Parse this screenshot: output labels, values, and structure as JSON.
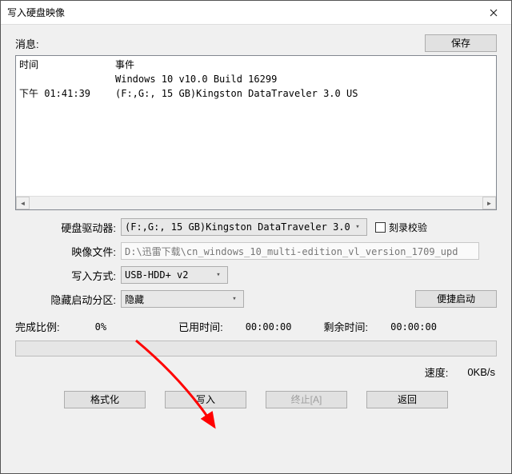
{
  "window": {
    "title": "写入硬盘映像"
  },
  "info_section": {
    "label": "消息:",
    "save_button": "保存",
    "headers": {
      "time": "时间",
      "event": "事件"
    },
    "rows": [
      {
        "time": "",
        "event": "Windows 10 v10.0 Build 16299"
      },
      {
        "time": "下午 01:41:39",
        "event": "(F:,G:, 15 GB)Kingston DataTraveler 3.0 US"
      }
    ]
  },
  "form": {
    "drive_label": "硬盘驱动器:",
    "drive_value": "(F:,G:, 15 GB)Kingston DataTraveler 3.0 ˇ",
    "verify_label": "刻录校验",
    "image_label": "映像文件:",
    "image_value": "D:\\迅雷下载\\cn_windows_10_multi-edition_vl_version_1709_upd",
    "write_mode_label": "写入方式:",
    "write_mode_value": "USB-HDD+ v2",
    "hidden_part_label": "隐藏启动分区:",
    "hidden_part_value": "隐藏",
    "quick_boot_button": "便捷启动"
  },
  "stats": {
    "done_pct_label": "完成比例:",
    "done_pct_value": "0%",
    "elapsed_label": "已用时间:",
    "elapsed_value": "00:00:00",
    "remaining_label": "剩余时间:",
    "remaining_value": "00:00:00",
    "speed_label": "速度:",
    "speed_value": "0KB/s"
  },
  "actions": {
    "format": "格式化",
    "write": "写入",
    "abort": "终止[A]",
    "back": "返回"
  }
}
